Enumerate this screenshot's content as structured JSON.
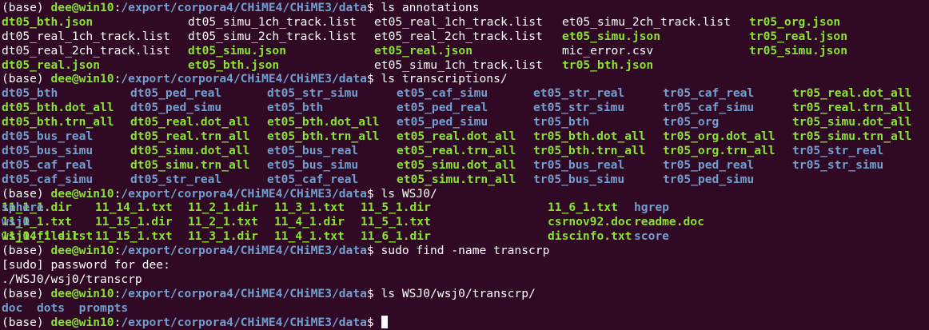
{
  "prompt": {
    "env": "(base) ",
    "user_host": "dee@win10",
    "sep": ":",
    "path": "/export/corpora4/CHiME4/CHiME3/data",
    "suffix": "$ "
  },
  "blocks": [
    {
      "command": "ls annotations",
      "columns_x": [
        0,
        233,
        466,
        701,
        935
      ],
      "rows": [
        [
          [
            "dt05_bth.json",
            "green"
          ],
          [
            "dt05_simu_1ch_track.list",
            "file"
          ],
          [
            "et05_real_1ch_track.list",
            "file"
          ],
          [
            "et05_simu_2ch_track.list",
            "file"
          ],
          [
            "tr05_org.json",
            "green"
          ]
        ],
        [
          [
            "dt05_real_1ch_track.list",
            "file"
          ],
          [
            "dt05_simu_2ch_track.list",
            "file"
          ],
          [
            "et05_real_2ch_track.list",
            "file"
          ],
          [
            "et05_simu.json",
            "green"
          ],
          [
            "tr05_real.json",
            "green"
          ]
        ],
        [
          [
            "dt05_real_2ch_track.list",
            "file"
          ],
          [
            "dt05_simu.json",
            "green"
          ],
          [
            "et05_real.json",
            "green"
          ],
          [
            "mic_error.csv",
            "file"
          ],
          [
            "tr05_simu.json",
            "green"
          ]
        ],
        [
          [
            "dt05_real.json",
            "green"
          ],
          [
            "et05_bth.json",
            "green"
          ],
          [
            "et05_simu_1ch_track.list",
            "file"
          ],
          [
            "tr05_bth.json",
            "green"
          ]
        ]
      ]
    },
    {
      "command": "ls transcriptions/",
      "columns_x": [
        0,
        161,
        332,
        494,
        665,
        827,
        989
      ],
      "rows": [
        [
          [
            "dt05_bth",
            "blue"
          ],
          [
            "dt05_ped_real",
            "blue"
          ],
          [
            "dt05_str_simu",
            "blue"
          ],
          [
            "et05_caf_simu",
            "blue"
          ],
          [
            "et05_str_real",
            "blue"
          ],
          [
            "tr05_caf_real",
            "blue"
          ],
          [
            "tr05_real.dot_all",
            "green"
          ]
        ],
        [
          [
            "dt05_bth.dot_all",
            "green"
          ],
          [
            "dt05_ped_simu",
            "blue"
          ],
          [
            "et05_bth",
            "blue"
          ],
          [
            "et05_ped_real",
            "blue"
          ],
          [
            "et05_str_simu",
            "blue"
          ],
          [
            "tr05_caf_simu",
            "blue"
          ],
          [
            "tr05_real.trn_all",
            "green"
          ]
        ],
        [
          [
            "dt05_bth.trn_all",
            "green"
          ],
          [
            "dt05_real.dot_all",
            "green"
          ],
          [
            "et05_bth.dot_all",
            "green"
          ],
          [
            "et05_ped_simu",
            "blue"
          ],
          [
            "tr05_bth",
            "blue"
          ],
          [
            "tr05_org",
            "blue"
          ],
          [
            "tr05_simu.dot_all",
            "green"
          ]
        ],
        [
          [
            "dt05_bus_real",
            "blue"
          ],
          [
            "dt05_real.trn_all",
            "green"
          ],
          [
            "et05_bth.trn_all",
            "green"
          ],
          [
            "et05_real.dot_all",
            "green"
          ],
          [
            "tr05_bth.dot_all",
            "green"
          ],
          [
            "tr05_org.dot_all",
            "green"
          ],
          [
            "tr05_simu.trn_all",
            "green"
          ]
        ],
        [
          [
            "dt05_bus_simu",
            "blue"
          ],
          [
            "dt05_simu.dot_all",
            "green"
          ],
          [
            "et05_bus_real",
            "blue"
          ],
          [
            "et05_real.trn_all",
            "green"
          ],
          [
            "tr05_bth.trn_all",
            "green"
          ],
          [
            "tr05_org.trn_all",
            "green"
          ],
          [
            "tr05_str_real",
            "blue"
          ]
        ],
        [
          [
            "dt05_caf_real",
            "blue"
          ],
          [
            "dt05_simu.trn_all",
            "green"
          ],
          [
            "et05_bus_simu",
            "blue"
          ],
          [
            "et05_simu.dot_all",
            "green"
          ],
          [
            "tr05_bus_real",
            "blue"
          ],
          [
            "tr05_ped_real",
            "blue"
          ],
          [
            "tr05_str_simu",
            "blue"
          ]
        ],
        [
          [
            "dt05_caf_simu",
            "blue"
          ],
          [
            "dt05_str_real",
            "blue"
          ],
          [
            "et05_caf_real",
            "blue"
          ],
          [
            "et05_simu.trn_all",
            "green"
          ],
          [
            "tr05_bus_simu",
            "blue"
          ],
          [
            "tr05_ped_simu",
            "blue"
          ]
        ]
      ]
    },
    {
      "command": "ls WSJ0/",
      "columns_x": [
        0,
        117,
        233,
        341,
        449,
        683,
        791
      ],
      "rows": [
        [
          [
            "11_1_1.dir",
            "green"
          ],
          [
            "11_14_1.txt",
            "green"
          ],
          [
            "11_2_1.dir",
            "green"
          ],
          [
            "11_3_1.txt",
            "green"
          ],
          [
            "11_5_1.dir",
            "green"
          ],
          [
            "11_6_1.txt",
            "green"
          ],
          [
            "hgrep",
            "blue"
          ],
          [
            "sphere",
            "blue"
          ]
        ],
        [
          [
            "11_1_1.txt",
            "green"
          ],
          [
            "11_15_1.dir",
            "green"
          ],
          [
            "11_2_1.txt",
            "green"
          ],
          [
            "11_4_1.dir",
            "green"
          ],
          [
            "11_5_1.txt",
            "green"
          ],
          [
            "csrnov92.doc",
            "green"
          ],
          [
            "readme.doc",
            "green"
          ],
          [
            "wsj0",
            "blue"
          ]
        ],
        [
          [
            "11_14_1.dir",
            "green"
          ],
          [
            "11_15_1.txt",
            "green"
          ],
          [
            "11_3_1.dir",
            "green"
          ],
          [
            "11_4_1.txt",
            "green"
          ],
          [
            "11_6_1.dir",
            "green"
          ],
          [
            "discinfo.txt",
            "green"
          ],
          [
            "score",
            "blue"
          ],
          [
            "wsj0.file.lst",
            "green"
          ]
        ]
      ]
    },
    {
      "command": "sudo find -name transcrp",
      "plain_lines": [
        "[sudo] password for dee:",
        "./WSJ0/wsj0/transcrp"
      ]
    },
    {
      "command": "ls WSJ0/wsj0/transcrp/",
      "inline_items": [
        [
          "doc",
          "blue"
        ],
        [
          "dots",
          "blue"
        ],
        [
          "prompts",
          "blue"
        ]
      ]
    }
  ],
  "final_prompt_cursor": true
}
